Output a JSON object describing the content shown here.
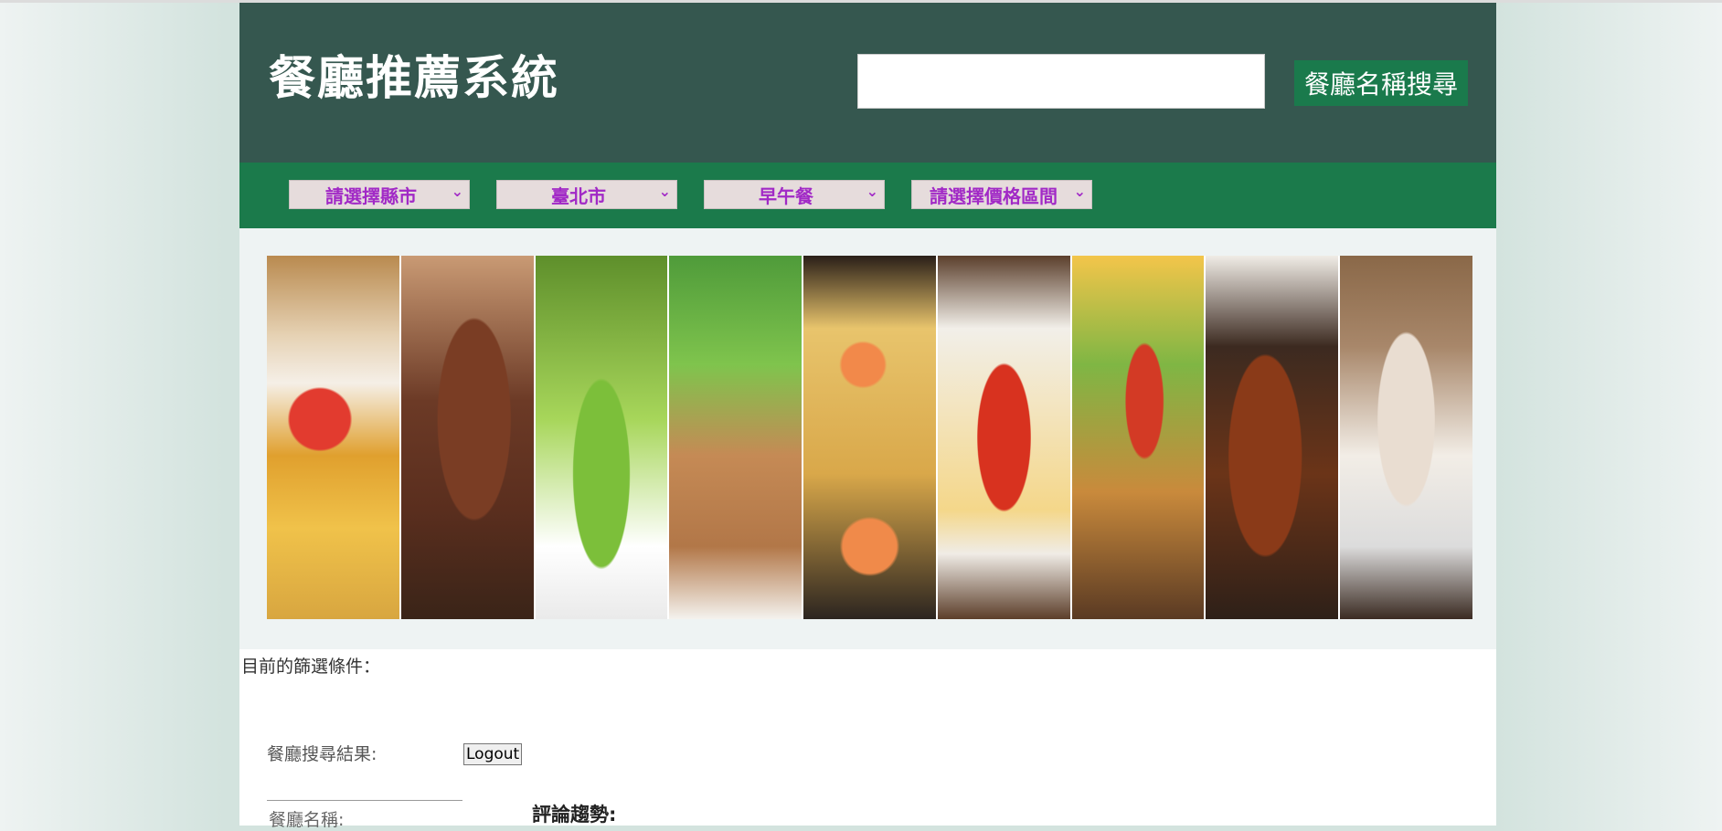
{
  "header": {
    "title": "餐廳推薦系統",
    "search": {
      "value": "",
      "placeholder": ""
    },
    "search_button": "餐廳名稱搜尋"
  },
  "filters": [
    {
      "name": "county",
      "label": "請選擇縣市"
    },
    {
      "name": "city",
      "label": "臺北市"
    },
    {
      "name": "meal",
      "label": "早午餐"
    },
    {
      "name": "price",
      "label": "請選擇價格區間"
    }
  ],
  "banner": {
    "panels": [
      "fries",
      "steak",
      "salad",
      "fish",
      "shrimp-noodles",
      "spaghetti",
      "tacos",
      "grilled-chicken",
      "cappuccino"
    ]
  },
  "current_filter_label": "目前的篩選條件：",
  "results_label": "餐廳搜尋結果:",
  "logout_label": "Logout",
  "restaurant_name_label": "餐廳名稱:",
  "trend_label": "評論趨勢:",
  "colors": {
    "header_bg": "#35574f",
    "filter_bar_bg": "#1b7a4b",
    "search_button_bg": "#1a7a4c",
    "select_text": "#a129c6",
    "select_bg": "#e6dcdc"
  }
}
